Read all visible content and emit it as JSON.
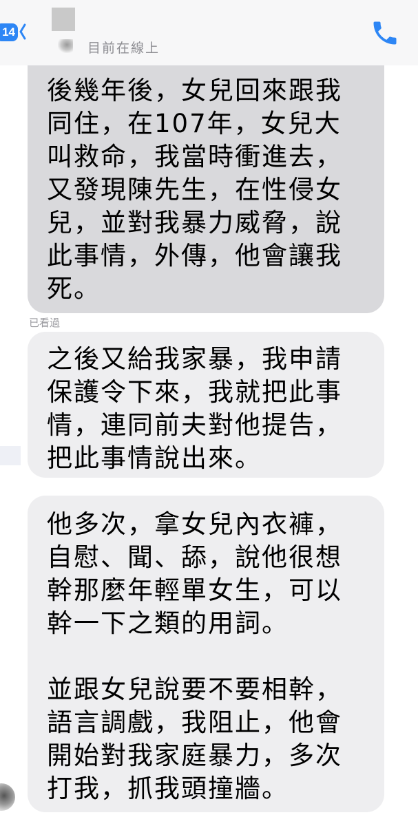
{
  "header": {
    "back_count": "14",
    "status": "目前在線上",
    "accent_color": "#2d86f5",
    "icons": [
      "chevron-left-icon",
      "phone-icon"
    ]
  },
  "messages": [
    {
      "lines": [
        "後幾年後，女兒回來跟我",
        "同住，在107年，女兒大",
        "叫救命，我當時衝進去，",
        "又發現陳先生，在性侵女",
        "兒，並對我暴力威脅，說",
        "此事情，外傳，他會讓我",
        "死。"
      ]
    },
    {
      "lines": [
        "之後又給我家暴，我申請",
        "保護令下來，我就把此事",
        "情，連同前夫對他提告，",
        "把此事情說出來。"
      ]
    },
    {
      "paragraphs": [
        [
          "他多次，拿女兒內衣褲，",
          "自慰、聞、舔，說他很想",
          "幹那麼年輕單女生，可以",
          "幹一下之類的用詞。"
        ],
        [
          "並跟女兒說要不要相幹，",
          "語言調戲，我阻止，他會",
          "開始對我家庭暴力，多次",
          "打我，抓我頭撞牆。"
        ]
      ]
    }
  ],
  "receipt": "已看過"
}
